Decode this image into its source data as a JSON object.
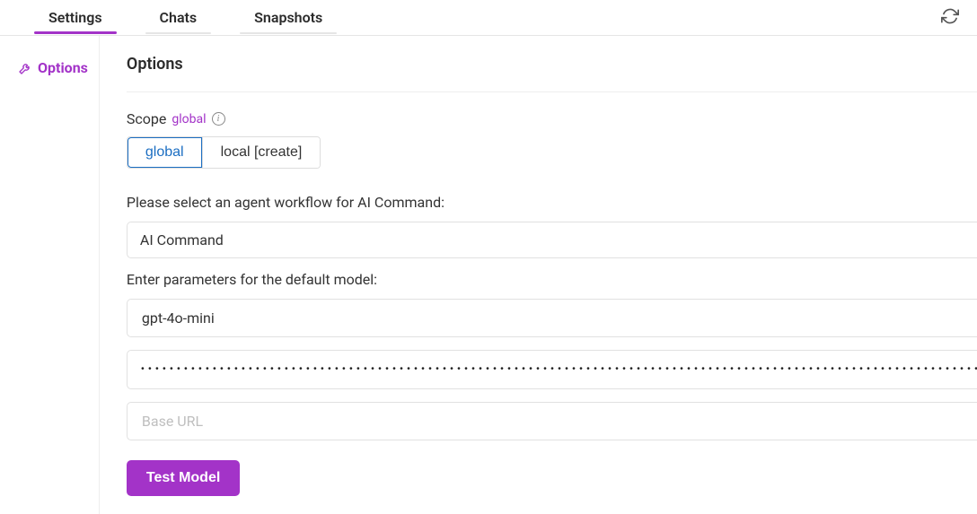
{
  "tabs": {
    "settings": "Settings",
    "chats": "Chats",
    "snapshots": "Snapshots"
  },
  "sidebar": {
    "options": "Options"
  },
  "main": {
    "title": "Options",
    "scope_label": "Scope",
    "scope_value": "global",
    "scope_buttons": {
      "global": "global",
      "local": "local [create]"
    },
    "workflow_label": "Please select an agent workflow for AI Command:",
    "workflow_selected": "AI Command",
    "params_label": "Enter parameters for the default model:",
    "model_value": "gpt-4o-mini",
    "api_key_masked": "••••••••••••••••••••••••••••••••••••••••••••••••••••••••••••••••••••••••••••••••••••••••••••••••••••••••••••••••••••••••••••••••••••••••••••••••••••••••••••••••",
    "base_url_value": "",
    "base_url_placeholder": "Base URL",
    "test_button": "Test Model"
  }
}
